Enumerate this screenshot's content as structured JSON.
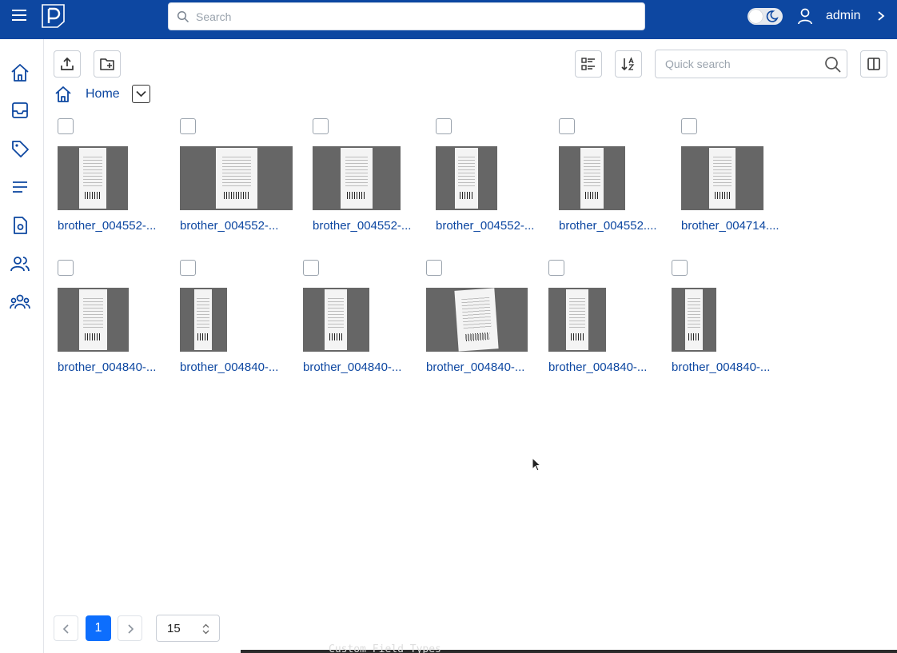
{
  "header": {
    "search_placeholder": "Search",
    "username": "admin"
  },
  "toolbar": {
    "quick_search_placeholder": "Quick search"
  },
  "breadcrumb": {
    "home_label": "Home"
  },
  "files": [
    {
      "name": "brother_004552-..."
    },
    {
      "name": "brother_004552-..."
    },
    {
      "name": "brother_004552-..."
    },
    {
      "name": "brother_004552-..."
    },
    {
      "name": "brother_004552...."
    },
    {
      "name": "brother_004714...."
    },
    {
      "name": "brother_004840-..."
    },
    {
      "name": "brother_004840-..."
    },
    {
      "name": "brother_004840-..."
    },
    {
      "name": "brother_004840-..."
    },
    {
      "name": "brother_004840-..."
    },
    {
      "name": "brother_004840-..."
    }
  ],
  "pagination": {
    "current_page": "1",
    "page_size": "15"
  },
  "background_window": {
    "text": "Custom Field Types"
  },
  "colors": {
    "primary": "#0d47a1",
    "accent": "#0d6efd",
    "thumb_bg": "#666666"
  }
}
